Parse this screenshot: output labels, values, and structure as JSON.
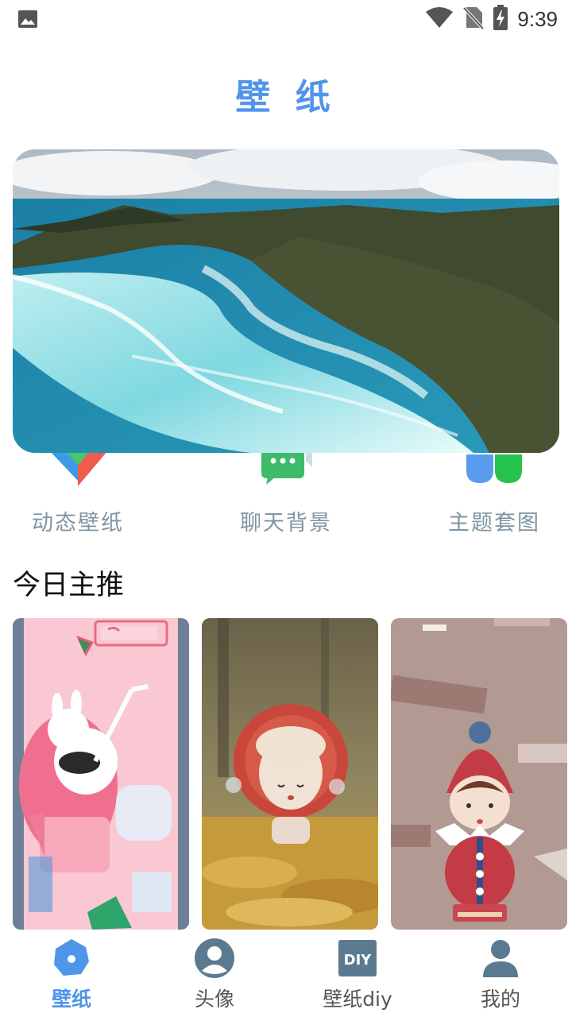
{
  "status_bar": {
    "time": "9:39",
    "icons": [
      "image-icon",
      "wifi-icon",
      "no-sim-icon",
      "battery-charging-icon"
    ]
  },
  "header": {
    "title": "壁 纸"
  },
  "banner": {
    "image": "aerial-beach-photo"
  },
  "categories": [
    {
      "label": "动态壁纸",
      "icon": "dynamic-wallpaper-icon"
    },
    {
      "label": "聊天背景",
      "icon": "chat-bubble-icon"
    },
    {
      "label": "主题套图",
      "icon": "theme-set-icon"
    }
  ],
  "featured": {
    "title": "今日主推",
    "items": [
      {
        "image": "watermelon-soda-illustration"
      },
      {
        "image": "flower-doll-photo"
      },
      {
        "image": "popmart-pucky-illustration"
      }
    ]
  },
  "bottom_nav": {
    "items": [
      {
        "label": "壁纸",
        "icon": "wallpaper-icon",
        "active": true
      },
      {
        "label": "头像",
        "icon": "avatar-icon",
        "active": false
      },
      {
        "label": "壁纸diy",
        "icon": "diy-icon",
        "active": false
      },
      {
        "label": "我的",
        "icon": "profile-icon",
        "active": false
      }
    ]
  },
  "colors": {
    "accent": "#4f95ea",
    "muted_label": "#7f95a4",
    "nav_icon": "#5b7a8f"
  }
}
